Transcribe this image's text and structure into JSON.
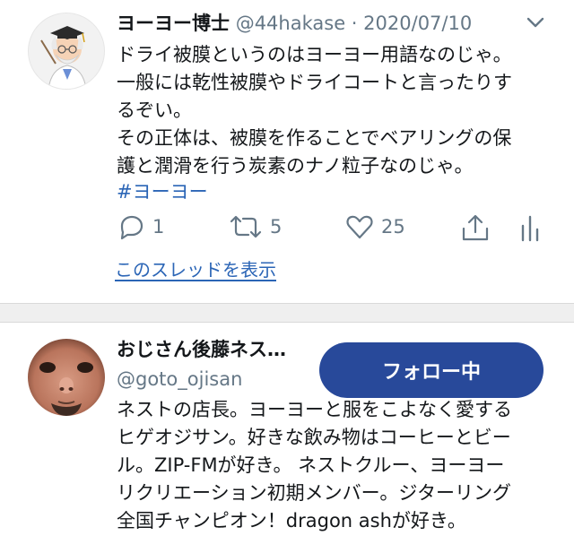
{
  "tweet": {
    "display_name": "ヨーヨー博士",
    "handle": "@44hakase",
    "separator": "·",
    "date": "2020/07/10",
    "avatar_icon": "professor-illustration",
    "menu_icon": "chevron-down-icon",
    "lines": [
      "ドライ被膜というのはヨーヨー用語なのじゃ。",
      "一般には乾性被膜やドライコートと言ったりす",
      "るぞい。",
      "その正体は、被膜を作ることでベアリングの保",
      "護と潤滑を行う炭素のナノ粒子なのじゃ。"
    ],
    "hashtag": "#ヨーヨー",
    "actions": {
      "reply_count": "1",
      "retweet_count": "5",
      "like_count": "25"
    },
    "thread_link": "このスレッドを表示"
  },
  "profile": {
    "display_name": "おじさん後藤ネス…",
    "handle": "@goto_ojisan",
    "follow_label": "フォロー中",
    "avatar_icon": "user-photo",
    "bio_lines": [
      "ネストの店長。ヨーヨーと服をこよなく愛する",
      "ヒゲオジサン。好きな飲み物はコーヒーとビー",
      "ル。ZIP-FMが好き。 ネストクルー、ヨーヨー",
      "リクリエーション初期メンバー。ジターリング",
      "全国チャンピオン！dragon ashが好き。"
    ]
  },
  "colors": {
    "link": "#2b65b6",
    "button": "#28499a",
    "muted": "#657786"
  }
}
